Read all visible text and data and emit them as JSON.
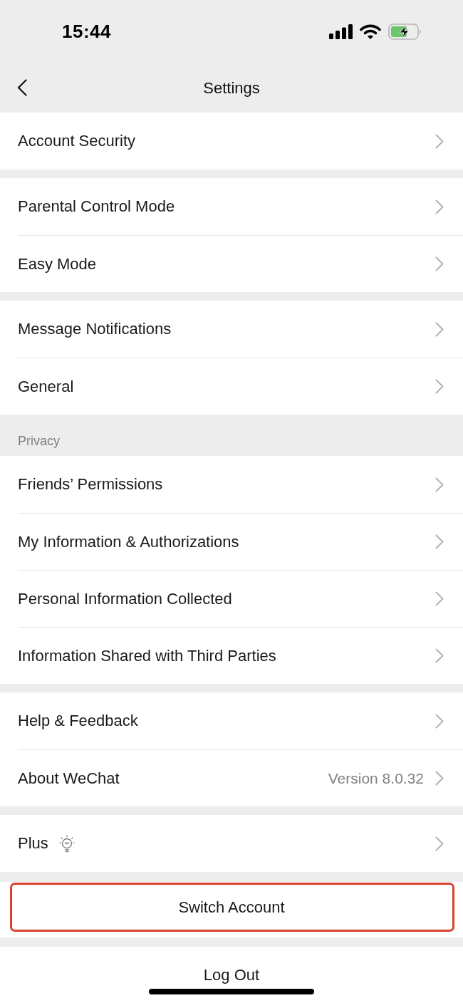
{
  "status_bar": {
    "time": "15:44"
  },
  "nav_bar": {
    "title": "Settings"
  },
  "groups": [
    {
      "items": [
        {
          "label": "Account Security",
          "kind": "plain"
        }
      ]
    },
    {
      "items": [
        {
          "label": "Parental Control Mode",
          "kind": "plain"
        },
        {
          "label": "Easy Mode",
          "kind": "plain"
        }
      ]
    },
    {
      "items": [
        {
          "label": "Message Notifications",
          "kind": "plain"
        },
        {
          "label": "General",
          "kind": "plain"
        }
      ]
    },
    {
      "header": "Privacy",
      "items": [
        {
          "label": "Friends’ Permissions",
          "kind": "plain"
        },
        {
          "label": "My Information & Authorizations",
          "kind": "plain"
        },
        {
          "label": "Personal Information Collected",
          "kind": "plain"
        },
        {
          "label": "Information Shared with Third Parties",
          "kind": "plain"
        }
      ]
    },
    {
      "items": [
        {
          "label": "Help & Feedback",
          "kind": "plain"
        },
        {
          "label": "About WeChat",
          "kind": "plain",
          "value": "Version 8.0.32"
        }
      ]
    },
    {
      "items": [
        {
          "label": "Plus",
          "kind": "icon"
        }
      ]
    }
  ],
  "actions": [
    {
      "label": "Switch Account",
      "highlighted": true
    },
    {
      "label": "Log Out",
      "highlighted": false
    }
  ]
}
